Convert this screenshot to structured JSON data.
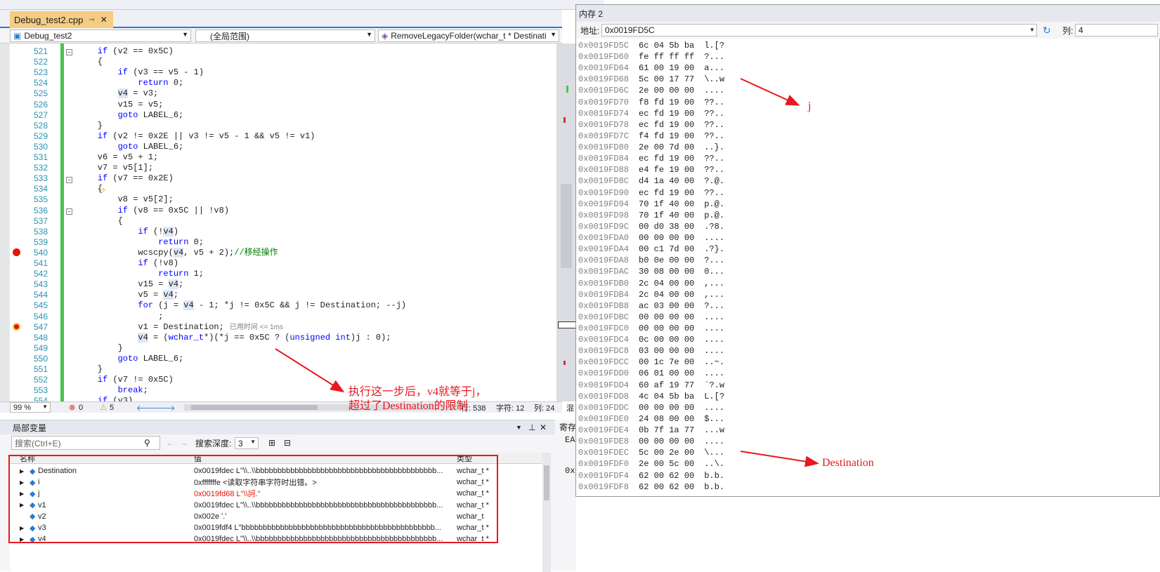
{
  "editor": {
    "tab_label": "Debug_test2.cpp",
    "nav": {
      "project": "Debug_test2",
      "scope": "(全局范围)",
      "function": "RemoveLegacyFolder(wchar_t * Destinati"
    },
    "lines": [
      {
        "n": "521",
        "t": "    if (v2 == 0x5C)"
      },
      {
        "n": "522",
        "t": "    {"
      },
      {
        "n": "523",
        "t": "        if (v3 == v5 - 1)"
      },
      {
        "n": "524",
        "t": "            return 0;"
      },
      {
        "n": "525",
        "t": "        v4 = v3;"
      },
      {
        "n": "526",
        "t": "        v15 = v5;"
      },
      {
        "n": "527",
        "t": "        goto LABEL_6;"
      },
      {
        "n": "528",
        "t": "    }"
      },
      {
        "n": "529",
        "t": "    if (v2 != 0x2E || v3 != v5 - 1 && v5 != v1)"
      },
      {
        "n": "530",
        "t": "        goto LABEL_6;"
      },
      {
        "n": "531",
        "t": "    v6 = v5 + 1;"
      },
      {
        "n": "532",
        "t": "    v7 = v5[1];"
      },
      {
        "n": "533",
        "t": "    if (v7 == 0x2E)"
      },
      {
        "n": "534",
        "t": "    {"
      },
      {
        "n": "535",
        "t": "        v8 = v5[2];"
      },
      {
        "n": "536",
        "t": "        if (v8 == 0x5C || !v8)"
      },
      {
        "n": "537",
        "t": "        {"
      },
      {
        "n": "538",
        "t": "            if (!v4)"
      },
      {
        "n": "539",
        "t": "                return 0;"
      },
      {
        "n": "540",
        "t": "            wcscpy(v4, v5 + 2);",
        "c": "//移经操作"
      },
      {
        "n": "541",
        "t": "            if (!v8)"
      },
      {
        "n": "542",
        "t": "                return 1;"
      },
      {
        "n": "543",
        "t": "            v15 = v4;"
      },
      {
        "n": "544",
        "t": "            v5 = v4;"
      },
      {
        "n": "545",
        "t": "            for (j = v4 - 1; *j != 0x5C && j != Destination; --j)"
      },
      {
        "n": "546",
        "t": "                ;"
      },
      {
        "n": "547",
        "t": "            v1 = Destination;",
        "p": "已用时间 <= 1ms"
      },
      {
        "n": "548",
        "t": "            v4 = (wchar_t*)(*j == 0x5C ? (unsigned int)j : 0);"
      },
      {
        "n": "549",
        "t": "        }"
      },
      {
        "n": "550",
        "t": "        goto LABEL_6;"
      },
      {
        "n": "551",
        "t": "    }"
      },
      {
        "n": "552",
        "t": "    if (v7 != 0x5C)"
      },
      {
        "n": "553",
        "t": "        break;"
      },
      {
        "n": "554",
        "t": "    if (v3)"
      }
    ],
    "status": {
      "zoom": "99 %",
      "errors": "0",
      "warnings": "5",
      "line": "行: 538",
      "char": "字符: 12",
      "col": "列: 24",
      "enc": "混"
    }
  },
  "locals": {
    "title": "局部变量",
    "search_placeholder": "搜索(Ctrl+E)",
    "depth_label": "搜索深度:",
    "depth_value": "3",
    "headers": [
      "名称",
      "值",
      "类型"
    ],
    "rows": [
      {
        "name": "Destination",
        "value": "0x0019fdec L\"\\\\..\\\\bbbbbbbbbbbbbbbbbbbbbbbbbbbbbbbbbbbbbbbbbb...",
        "type": "wchar_t *"
      },
      {
        "name": "i",
        "value": "0xfffffffe <读取字符串字符时出错。>",
        "type": "wchar_t *"
      },
      {
        "name": "j",
        "value": "0x0019fd68 L\"\\\\訶.\"",
        "type": "wchar_t *"
      },
      {
        "name": "v1",
        "value": "0x0019fdec L\"\\\\..\\\\bbbbbbbbbbbbbbbbbbbbbbbbbbbbbbbbbbbbbbbbbb...",
        "type": "wchar_t *"
      },
      {
        "name": "v2",
        "value": "0x002e '.'",
        "type": "wchar_t"
      },
      {
        "name": "v3",
        "value": "0x0019fdf4 L\"bbbbbbbbbbbbbbbbbbbbbbbbbbbbbbbbbbbbbbbbbbbbb...",
        "type": "wchar_t *"
      },
      {
        "name": "v4",
        "value": "0x0019fdec L\"\\\\..\\\\bbbbbbbbbbbbbbbbbbbbbbbbbbbbbbbbbbbbbbbbbb...",
        "type": "wchar_t *"
      }
    ]
  },
  "registers": {
    "title": "寄存",
    "eax": "EA",
    "ox": "0x"
  },
  "memory": {
    "title": "内存 2",
    "addr_label": "地址:",
    "addr_value": "0x0019FD5C",
    "col_label": "列:",
    "col_value": "4",
    "rows": [
      {
        "a": "0x0019FD5C",
        "b": "6c 04 5b ba",
        "s": "l.[?"
      },
      {
        "a": "0x0019FD60",
        "b": "fe ff ff ff",
        "s": "?..."
      },
      {
        "a": "0x0019FD64",
        "b": "61 00 19 00",
        "s": "a..."
      },
      {
        "a": "0x0019FD68",
        "b": "5c 00 17 77",
        "s": "\\..w"
      },
      {
        "a": "0x0019FD6C",
        "b": "2e 00 00 00",
        "s": "...."
      },
      {
        "a": "0x0019FD70",
        "b": "f8 fd 19 00",
        "s": "??.."
      },
      {
        "a": "0x0019FD74",
        "b": "ec fd 19 00",
        "s": "??.."
      },
      {
        "a": "0x0019FD78",
        "b": "ec fd 19 00",
        "s": "??.."
      },
      {
        "a": "0x0019FD7C",
        "b": "f4 fd 19 00",
        "s": "??.."
      },
      {
        "a": "0x0019FD80",
        "b": "2e 00 7d 00",
        "s": "..}."
      },
      {
        "a": "0x0019FD84",
        "b": "ec fd 19 00",
        "s": "??.."
      },
      {
        "a": "0x0019FD88",
        "b": "e4 fe 19 00",
        "s": "??.."
      },
      {
        "a": "0x0019FD8C",
        "b": "d4 1a 40 00",
        "s": "?.@."
      },
      {
        "a": "0x0019FD90",
        "b": "ec fd 19 00",
        "s": "??.."
      },
      {
        "a": "0x0019FD94",
        "b": "70 1f 40 00",
        "s": "p.@."
      },
      {
        "a": "0x0019FD98",
        "b": "70 1f 40 00",
        "s": "p.@."
      },
      {
        "a": "0x0019FD9C",
        "b": "00 d0 38 00",
        "s": ".?8."
      },
      {
        "a": "0x0019FDA0",
        "b": "00 00 00 00",
        "s": "...."
      },
      {
        "a": "0x0019FDA4",
        "b": "00 c1 7d 00",
        "s": ".?}."
      },
      {
        "a": "0x0019FDA8",
        "b": "b0 0e 00 00",
        "s": "?..."
      },
      {
        "a": "0x0019FDAC",
        "b": "30 08 00 00",
        "s": "0..."
      },
      {
        "a": "0x0019FDB0",
        "b": "2c 04 00 00",
        "s": ",..."
      },
      {
        "a": "0x0019FDB4",
        "b": "2c 04 00 00",
        "s": ",..."
      },
      {
        "a": "0x0019FDB8",
        "b": "ac 03 00 00",
        "s": "?..."
      },
      {
        "a": "0x0019FDBC",
        "b": "00 00 00 00",
        "s": "...."
      },
      {
        "a": "0x0019FDC0",
        "b": "00 00 00 00",
        "s": "...."
      },
      {
        "a": "0x0019FDC4",
        "b": "0c 00 00 00",
        "s": "...."
      },
      {
        "a": "0x0019FDC8",
        "b": "03 00 00 00",
        "s": "...."
      },
      {
        "a": "0x0019FDCC",
        "b": "00 1c 7e 00",
        "s": "..~."
      },
      {
        "a": "0x0019FDD0",
        "b": "06 01 00 00",
        "s": "...."
      },
      {
        "a": "0x0019FDD4",
        "b": "60 af 19 77",
        "s": "`?.w"
      },
      {
        "a": "0x0019FDD8",
        "b": "4c 04 5b ba",
        "s": "L.[?"
      },
      {
        "a": "0x0019FDDC",
        "b": "00 00 00 00",
        "s": "...."
      },
      {
        "a": "0x0019FDE0",
        "b": "24 08 00 00",
        "s": "$..."
      },
      {
        "a": "0x0019FDE4",
        "b": "0b 7f 1a 77",
        "s": "...w"
      },
      {
        "a": "0x0019FDE8",
        "b": "00 00 00 00",
        "s": "...."
      },
      {
        "a": "0x0019FDEC",
        "b": "5c 00 2e 00",
        "s": "\\..."
      },
      {
        "a": "0x0019FDF0",
        "b": "2e 00 5c 00",
        "s": "..\\."
      },
      {
        "a": "0x0019FDF4",
        "b": "62 00 62 00",
        "s": "b.b."
      },
      {
        "a": "0x0019FDF8",
        "b": "62 00 62 00",
        "s": "b.b."
      }
    ]
  },
  "annotations": {
    "j": "j",
    "destination": "Destination",
    "step_note": "执行这一步后，v4就等于j，\n超过了Destination的限制"
  },
  "colors": {
    "accent": "#2e7ad1",
    "annotation": "#e8181e",
    "tab": "#f5cc84",
    "line_number": "#2b91af"
  }
}
